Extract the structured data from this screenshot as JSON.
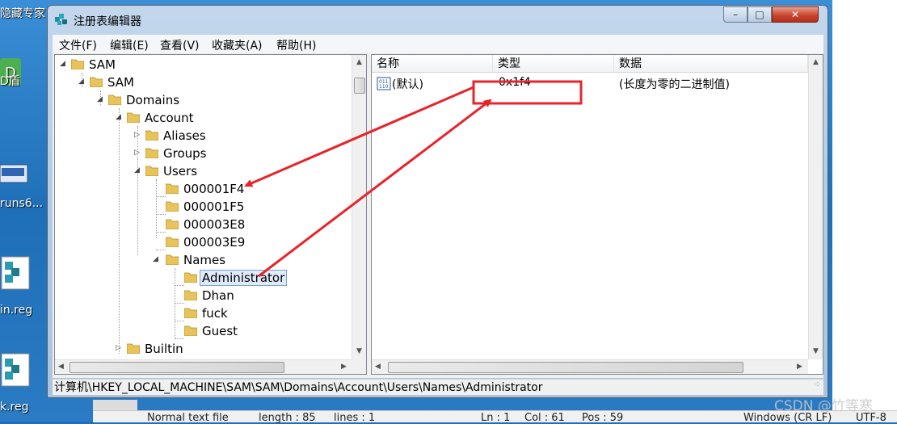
{
  "desktop": {
    "icons": [
      {
        "label": "隐藏专家"
      },
      {
        "label": "D盾"
      },
      {
        "label": "runs6..."
      },
      {
        "label": "in.reg"
      },
      {
        "label": "k.reg"
      }
    ]
  },
  "background_editor": {
    "status": {
      "mode": "Normal text file",
      "length": "length : 85",
      "lines": "lines : 1",
      "ln": "Ln : 1",
      "col": "Col : 61",
      "pos": "Pos : 59",
      "eol": "Windows (CR LF)",
      "encoding": "UTF-8"
    }
  },
  "watermark": "CSDN @竹等寒",
  "window": {
    "title": "注册表编辑器",
    "controls": {
      "minimize": "–",
      "maximize": "□",
      "close": "✕"
    }
  },
  "menu": {
    "items": [
      "文件(F)",
      "编辑(E)",
      "查看(V)",
      "收藏夹(A)",
      "帮助(H)"
    ]
  },
  "tree": {
    "nodes": [
      {
        "label": "SAM"
      },
      {
        "label": "SAM"
      },
      {
        "label": "Domains"
      },
      {
        "label": "Account"
      },
      {
        "label": "Aliases"
      },
      {
        "label": "Groups"
      },
      {
        "label": "Users"
      },
      {
        "label": "000001F4"
      },
      {
        "label": "000001F5"
      },
      {
        "label": "000003E8"
      },
      {
        "label": "000003E9"
      },
      {
        "label": "Names"
      },
      {
        "label": "Administrator"
      },
      {
        "label": "Dhan"
      },
      {
        "label": "fuck"
      },
      {
        "label": "Guest"
      },
      {
        "label": "Builtin"
      }
    ],
    "selected": "Administrator"
  },
  "list": {
    "columns": [
      "名称",
      "类型",
      "数据"
    ],
    "rows": [
      {
        "name": "(默认)",
        "type": "0x1f4",
        "data": "(长度为零的二进制值)"
      }
    ]
  },
  "statusbar": {
    "path": "计算机\\HKEY_LOCAL_MACHINE\\SAM\\SAM\\Domains\\Account\\Users\\Names\\Administrator"
  },
  "annotations": {
    "color": "#e8242b"
  },
  "colors": {
    "selection": "#dfeafa",
    "annotation": "#e8242b",
    "folder": "#e8c35a"
  }
}
